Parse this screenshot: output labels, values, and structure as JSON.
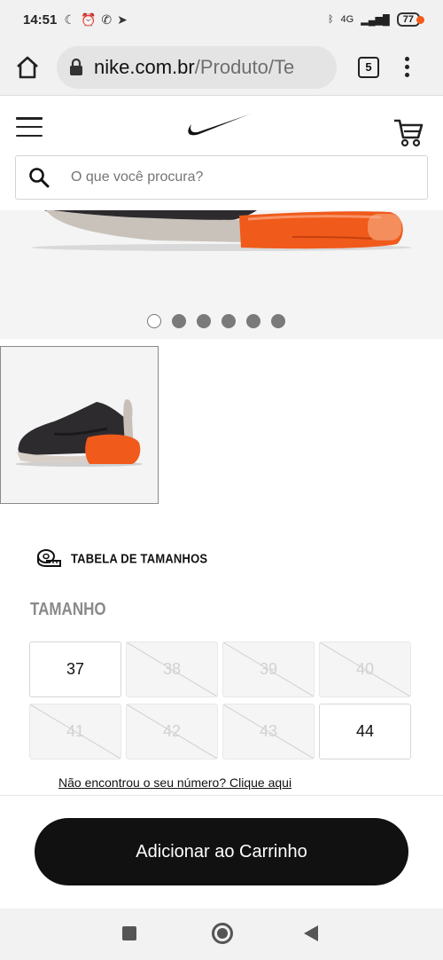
{
  "status_bar": {
    "time": "14:51",
    "network": "4G",
    "battery": "77",
    "icons": [
      "moon-icon",
      "alarm-icon",
      "whatsapp-icon",
      "telegram-icon",
      "bluetooth-icon",
      "signal-icon",
      "battery-icon"
    ]
  },
  "browser": {
    "url_domain": "nike.com.br",
    "url_path": "/Produto/Te",
    "tab_count": "5"
  },
  "header": {
    "search_placeholder": "O que você procura?",
    "cart_badge_color": "#f25c19"
  },
  "gallery": {
    "dot_count": 6,
    "active_dot": 0
  },
  "size_guide": {
    "label": "TABELA DE TAMANHOS"
  },
  "sizes": {
    "title": "TAMANHO",
    "options": [
      {
        "label": "37",
        "available": true
      },
      {
        "label": "38",
        "available": false
      },
      {
        "label": "39",
        "available": false
      },
      {
        "label": "40",
        "available": false
      },
      {
        "label": "41",
        "available": false
      },
      {
        "label": "42",
        "available": false
      },
      {
        "label": "43",
        "available": false
      },
      {
        "label": "44",
        "available": true
      }
    ],
    "not_found_link": "Não encontrou o seu número? Clique aqui"
  },
  "cta": {
    "add_to_cart": "Adicionar ao Carrinho"
  },
  "colors": {
    "accent_orange": "#f25c19",
    "button_black": "#111111"
  }
}
